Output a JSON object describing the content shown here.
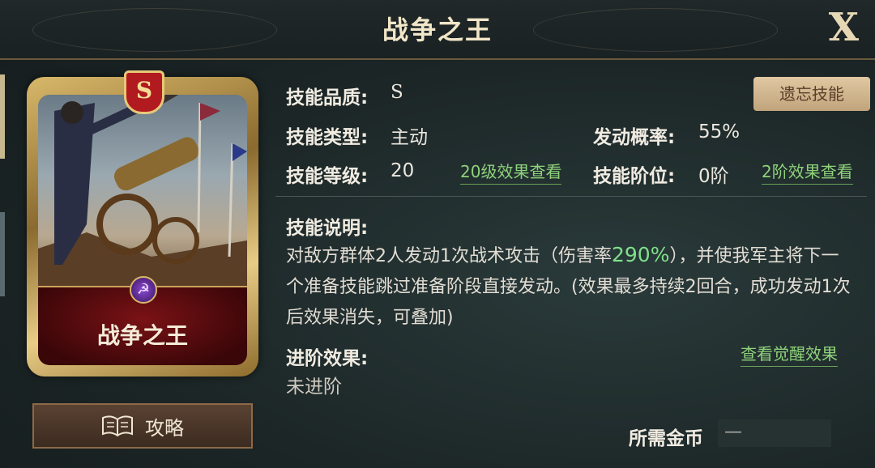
{
  "header": {
    "title": "战争之王",
    "close_label": "X"
  },
  "card": {
    "grade": "S",
    "name": "战争之王",
    "type_icon": "crossed-hammer-icon"
  },
  "guide_button": {
    "label": "攻略",
    "icon": "book-icon"
  },
  "forget_button": {
    "label": "遗忘技能"
  },
  "stats": {
    "quality_label": "技能品质:",
    "quality_value": "S",
    "type_label": "技能类型:",
    "type_value": "主动",
    "rate_label": "发动概率:",
    "rate_value": "55%",
    "level_label": "技能等级:",
    "level_value": "20",
    "level_link": "20级效果查看",
    "rank_label": "技能阶位:",
    "rank_value": "0阶",
    "rank_link": "2阶效果查看"
  },
  "description": {
    "label": "技能说明:",
    "text_before": "对敌方群体2人发动1次战术攻击（伤害率",
    "highlight": "290%",
    "text_after": "），并使我军主将下一个准备技能跳过准备阶段直接发动。(效果最多持续2回合，成功发动1次后效果消失，可叠加)"
  },
  "advance": {
    "label": "进阶效果:",
    "value": "未进阶",
    "awaken_link": "查看觉醒效果"
  },
  "cost": {
    "label": "所需金币",
    "value": "—"
  },
  "colors": {
    "highlight_green": "#7fe08a",
    "link_green": "#8ed27a",
    "gold": "#d8b86a"
  }
}
